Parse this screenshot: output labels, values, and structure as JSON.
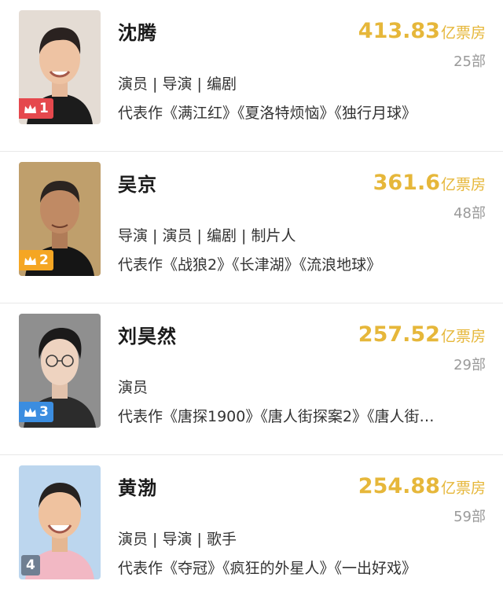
{
  "colors": {
    "gold": "#e6b73a",
    "rank1_badge": "#e5484d",
    "rank2_badge": "#f5a623",
    "rank3_badge": "#3b8de0",
    "rank4_badge": "#6f7f92"
  },
  "actors": [
    {
      "rank": "1",
      "crown_icon": "crown-icon",
      "name": "沈腾",
      "box_office": "413.83",
      "box_office_unit": "亿票房",
      "works": "25部",
      "roles": "演员 | 导演 | 编剧",
      "representative": "代表作《满江红》《夏洛特烦恼》《独行月球》"
    },
    {
      "rank": "2",
      "crown_icon": "crown-icon",
      "name": "吴京",
      "box_office": "361.6",
      "box_office_unit": "亿票房",
      "works": "48部",
      "roles": "导演 | 演员 | 编剧 | 制片人",
      "representative": "代表作《战狼2》《长津湖》《流浪地球》"
    },
    {
      "rank": "3",
      "crown_icon": "crown-icon",
      "name": "刘昊然",
      "box_office": "257.52",
      "box_office_unit": "亿票房",
      "works": "29部",
      "roles": "演员",
      "representative": "代表作《唐探1900》《唐人街探案2》《唐人街…"
    },
    {
      "rank": "4",
      "name": "黄渤",
      "box_office": "254.88",
      "box_office_unit": "亿票房",
      "works": "59部",
      "roles": "演员 | 导演 | 歌手",
      "representative": "代表作《夺冠》《疯狂的外星人》《一出好戏》"
    }
  ]
}
